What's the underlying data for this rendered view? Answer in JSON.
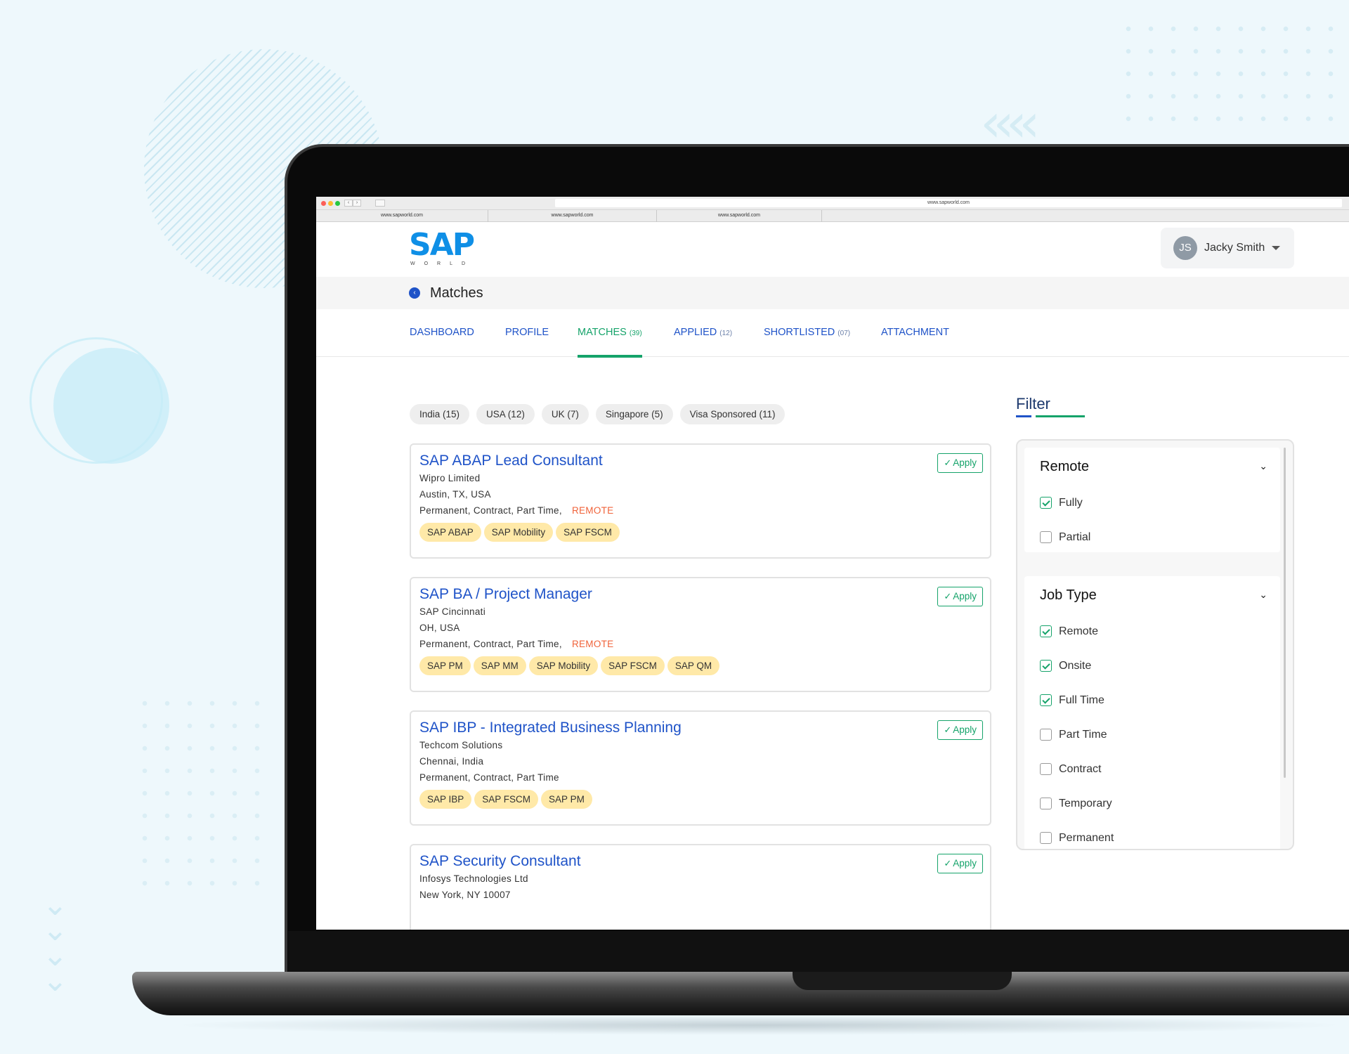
{
  "browser": {
    "url": "www.sapworld.com",
    "tabs": [
      "www.sapworld.com",
      "www.sapworld.com",
      "www.sapworld.com"
    ]
  },
  "logo": {
    "name": "SAP",
    "tagline": "WORLD"
  },
  "user": {
    "initials": "JS",
    "name": "Jacky Smith"
  },
  "page": {
    "title": "Matches"
  },
  "nav_tabs": [
    {
      "label": "DASHBOARD",
      "count": ""
    },
    {
      "label": "PROFILE",
      "count": ""
    },
    {
      "label": "MATCHES",
      "count": "(39)"
    },
    {
      "label": "APPLIED",
      "count": "(12)"
    },
    {
      "label": "SHORTLISTED",
      "count": "(07)"
    },
    {
      "label": "ATTACHMENT",
      "count": ""
    }
  ],
  "location_chips": [
    "India (15)",
    "USA (12)",
    "UK (7)",
    "Singapore (5)",
    "Visa Sponsored (11)"
  ],
  "apply_label": "Apply",
  "jobs": [
    {
      "title": "SAP ABAP Lead Consultant",
      "company": "Wipro Limited",
      "location": "Austin, TX, USA",
      "types": "Permanent, Contract, Part Time,",
      "remote": "REMOTE",
      "skills": [
        "SAP ABAP",
        "SAP Mobility",
        "SAP FSCM"
      ]
    },
    {
      "title": "SAP BA / Project Manager",
      "company": "SAP Cincinnati",
      "location": "OH, USA",
      "types": "Permanent, Contract, Part Time,",
      "remote": "REMOTE",
      "skills": [
        "SAP PM",
        "SAP MM",
        "SAP Mobility",
        "SAP FSCM",
        "SAP QM"
      ]
    },
    {
      "title": "SAP IBP - Integrated Business Planning",
      "company": "Techcom Solutions",
      "location": "Chennai, India",
      "types": "Permanent, Contract, Part Time",
      "remote": "",
      "skills": [
        "SAP IBP",
        "SAP FSCM",
        "SAP PM"
      ]
    },
    {
      "title": "SAP Security Consultant",
      "company": "Infosys Technologies Ltd",
      "location": "New York, NY 10007"
    }
  ],
  "filter": {
    "title": "Filter",
    "sections": [
      {
        "title": "Remote",
        "options": [
          {
            "label": "Fully",
            "checked": true
          },
          {
            "label": "Partial",
            "checked": false
          }
        ]
      },
      {
        "title": "Job Type",
        "options": [
          {
            "label": "Remote",
            "checked": true
          },
          {
            "label": "Onsite",
            "checked": true
          },
          {
            "label": "Full Time",
            "checked": true
          },
          {
            "label": "Part Time",
            "checked": false
          },
          {
            "label": "Contract",
            "checked": false
          },
          {
            "label": "Temporary",
            "checked": false
          },
          {
            "label": "Permanent",
            "checked": false
          }
        ]
      }
    ]
  },
  "colors": {
    "primary_blue": "#1f53c8",
    "accent_green": "#15a36a",
    "remote_orange": "#f0633a",
    "skill_yellow": "#ffe9a8"
  }
}
